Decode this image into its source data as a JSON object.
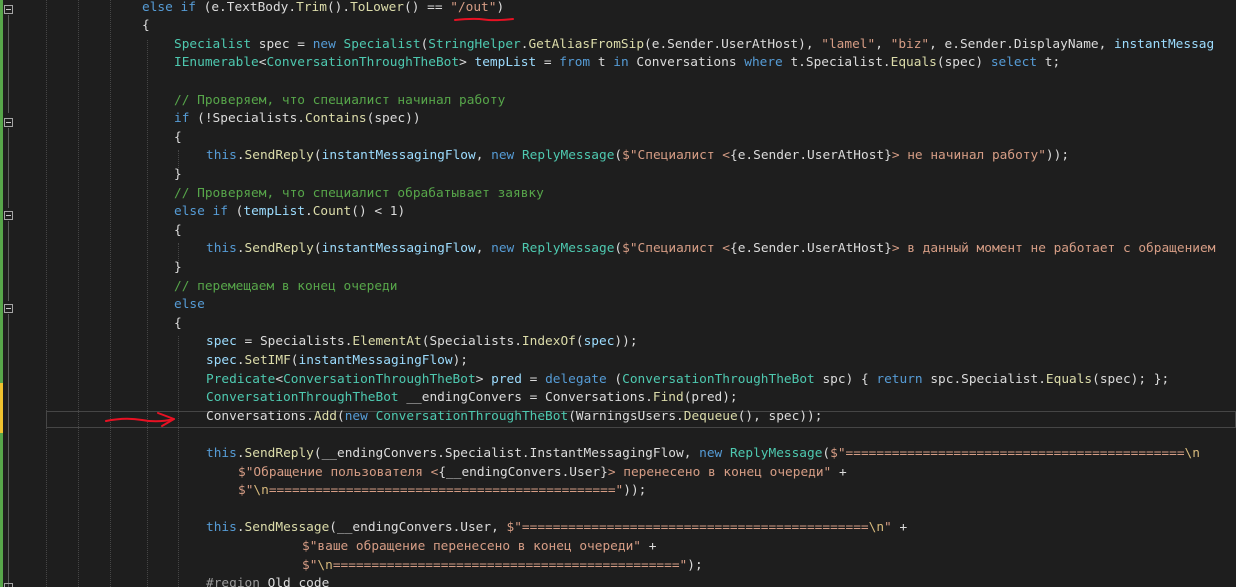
{
  "editor": {
    "lines": [
      [
        {
          "t": "else if",
          "c": "kw"
        },
        {
          "t": " (e.TextBody.",
          "c": "tx"
        },
        {
          "t": "Trim",
          "c": "me"
        },
        {
          "t": "().",
          "c": "tx"
        },
        {
          "t": "ToLower",
          "c": "me"
        },
        {
          "t": "() == ",
          "c": "tx"
        },
        {
          "t": "\"/out\"",
          "c": "st"
        },
        {
          "t": ")",
          "c": "tx"
        }
      ],
      [
        {
          "t": "{",
          "c": "tx"
        }
      ],
      [
        {
          "t": "Specialist",
          "c": "ty"
        },
        {
          "t": " spec = ",
          "c": "tx"
        },
        {
          "t": "new",
          "c": "kw"
        },
        {
          "t": " ",
          "c": "tx"
        },
        {
          "t": "Specialist",
          "c": "ty"
        },
        {
          "t": "(",
          "c": "tx"
        },
        {
          "t": "StringHelper",
          "c": "ty"
        },
        {
          "t": ".",
          "c": "tx"
        },
        {
          "t": "GetAliasFromSip",
          "c": "me"
        },
        {
          "t": "(e.Sender.UserAtHost), ",
          "c": "tx"
        },
        {
          "t": "\"lamel\"",
          "c": "st"
        },
        {
          "t": ", ",
          "c": "tx"
        },
        {
          "t": "\"biz\"",
          "c": "st"
        },
        {
          "t": ", e.Sender.DisplayName, ",
          "c": "tx"
        },
        {
          "t": "instantMessag",
          "c": "pa"
        }
      ],
      [
        {
          "t": "IEnumerable",
          "c": "ty"
        },
        {
          "t": "<",
          "c": "tx"
        },
        {
          "t": "ConversationThroughTheBot",
          "c": "ty"
        },
        {
          "t": "> ",
          "c": "tx"
        },
        {
          "t": "tempList",
          "c": "pa"
        },
        {
          "t": " = ",
          "c": "tx"
        },
        {
          "t": "from",
          "c": "kw"
        },
        {
          "t": " t ",
          "c": "tx"
        },
        {
          "t": "in",
          "c": "kw"
        },
        {
          "t": " Conversations ",
          "c": "tx"
        },
        {
          "t": "where",
          "c": "kw"
        },
        {
          "t": " t.Specialist.",
          "c": "tx"
        },
        {
          "t": "Equals",
          "c": "me"
        },
        {
          "t": "(spec) ",
          "c": "tx"
        },
        {
          "t": "select",
          "c": "kw"
        },
        {
          "t": " t;",
          "c": "tx"
        }
      ],
      [],
      [
        {
          "t": "// Проверяем, что специалист начинал работу",
          "c": "cm"
        }
      ],
      [
        {
          "t": "if",
          "c": "kw"
        },
        {
          "t": " (!Specialists.",
          "c": "tx"
        },
        {
          "t": "Contains",
          "c": "me"
        },
        {
          "t": "(spec))",
          "c": "tx"
        }
      ],
      [
        {
          "t": "{",
          "c": "tx"
        }
      ],
      [
        {
          "t": "this",
          "c": "kw"
        },
        {
          "t": ".",
          "c": "tx"
        },
        {
          "t": "SendReply",
          "c": "me"
        },
        {
          "t": "(",
          "c": "tx"
        },
        {
          "t": "instantMessagingFlow",
          "c": "pa"
        },
        {
          "t": ", ",
          "c": "tx"
        },
        {
          "t": "new",
          "c": "kw"
        },
        {
          "t": " ",
          "c": "tx"
        },
        {
          "t": "ReplyMessage",
          "c": "ty"
        },
        {
          "t": "(",
          "c": "tx"
        },
        {
          "t": "$\"Специалист <",
          "c": "st"
        },
        {
          "t": "{e.Sender.UserAtHost}",
          "c": "tx"
        },
        {
          "t": "> не начинал работу\"",
          "c": "st"
        },
        {
          "t": "));",
          "c": "tx"
        }
      ],
      [
        {
          "t": "}",
          "c": "tx"
        }
      ],
      [
        {
          "t": "// Проверяем, что специалист обрабатывает заявку",
          "c": "cm"
        }
      ],
      [
        {
          "t": "else if",
          "c": "kw"
        },
        {
          "t": " (",
          "c": "tx"
        },
        {
          "t": "tempList",
          "c": "pa"
        },
        {
          "t": ".",
          "c": "tx"
        },
        {
          "t": "Count",
          "c": "me"
        },
        {
          "t": "() < 1)",
          "c": "tx"
        }
      ],
      [
        {
          "t": "{",
          "c": "tx"
        }
      ],
      [
        {
          "t": "this",
          "c": "kw"
        },
        {
          "t": ".",
          "c": "tx"
        },
        {
          "t": "SendReply",
          "c": "me"
        },
        {
          "t": "(",
          "c": "tx"
        },
        {
          "t": "instantMessagingFlow",
          "c": "pa"
        },
        {
          "t": ", ",
          "c": "tx"
        },
        {
          "t": "new",
          "c": "kw"
        },
        {
          "t": " ",
          "c": "tx"
        },
        {
          "t": "ReplyMessage",
          "c": "ty"
        },
        {
          "t": "(",
          "c": "tx"
        },
        {
          "t": "$\"Специалист <",
          "c": "st"
        },
        {
          "t": "{e.Sender.UserAtHost}",
          "c": "tx"
        },
        {
          "t": "> в данный момент не работает с обращением",
          "c": "st"
        }
      ],
      [
        {
          "t": "}",
          "c": "tx"
        }
      ],
      [
        {
          "t": "// перемещаем в конец очереди",
          "c": "cm"
        }
      ],
      [
        {
          "t": "else",
          "c": "kw"
        }
      ],
      [
        {
          "t": "{",
          "c": "tx"
        }
      ],
      [
        {
          "t": "spec",
          "c": "pa"
        },
        {
          "t": " = Specialists.",
          "c": "tx"
        },
        {
          "t": "ElementAt",
          "c": "me"
        },
        {
          "t": "(Specialists.",
          "c": "tx"
        },
        {
          "t": "IndexOf",
          "c": "me"
        },
        {
          "t": "(",
          "c": "tx"
        },
        {
          "t": "spec",
          "c": "pa"
        },
        {
          "t": "));",
          "c": "tx"
        }
      ],
      [
        {
          "t": "spec",
          "c": "pa"
        },
        {
          "t": ".",
          "c": "tx"
        },
        {
          "t": "SetIMF",
          "c": "me"
        },
        {
          "t": "(",
          "c": "tx"
        },
        {
          "t": "instantMessagingFlow",
          "c": "pa"
        },
        {
          "t": ");",
          "c": "tx"
        }
      ],
      [
        {
          "t": "Predicate",
          "c": "ty"
        },
        {
          "t": "<",
          "c": "tx"
        },
        {
          "t": "ConversationThroughTheBot",
          "c": "ty"
        },
        {
          "t": "> ",
          "c": "tx"
        },
        {
          "t": "pred",
          "c": "pa"
        },
        {
          "t": " = ",
          "c": "tx"
        },
        {
          "t": "delegate",
          "c": "kw"
        },
        {
          "t": " (",
          "c": "tx"
        },
        {
          "t": "ConversationThroughTheBot",
          "c": "ty"
        },
        {
          "t": " spc) { ",
          "c": "tx"
        },
        {
          "t": "return",
          "c": "kw"
        },
        {
          "t": " spc.Specialist.",
          "c": "tx"
        },
        {
          "t": "Equals",
          "c": "me"
        },
        {
          "t": "(spec); };",
          "c": "tx"
        }
      ],
      [
        {
          "t": "ConversationThroughTheBot",
          "c": "ty"
        },
        {
          "t": " __endingConvers = Conversations.",
          "c": "tx"
        },
        {
          "t": "Find",
          "c": "me"
        },
        {
          "t": "(pred);",
          "c": "tx"
        }
      ],
      [
        {
          "t": "Conversations.",
          "c": "tx"
        },
        {
          "t": "Add",
          "c": "me"
        },
        {
          "t": "(",
          "c": "tx"
        },
        {
          "t": "new",
          "c": "kw"
        },
        {
          "t": " ",
          "c": "tx"
        },
        {
          "t": "ConversationThroughTheBot",
          "c": "ty"
        },
        {
          "t": "(WarningsUsers.",
          "c": "tx"
        },
        {
          "t": "Dequeue",
          "c": "me"
        },
        {
          "t": "(), spec));",
          "c": "tx"
        }
      ],
      [],
      [
        {
          "t": "this",
          "c": "kw"
        },
        {
          "t": ".",
          "c": "tx"
        },
        {
          "t": "SendReply",
          "c": "me"
        },
        {
          "t": "(__endingConvers.Specialist.InstantMessagingFlow, ",
          "c": "tx"
        },
        {
          "t": "new",
          "c": "kw"
        },
        {
          "t": " ",
          "c": "tx"
        },
        {
          "t": "ReplyMessage",
          "c": "ty"
        },
        {
          "t": "(",
          "c": "tx"
        },
        {
          "t": "$\"============================================",
          "c": "st"
        },
        {
          "t": "\\n",
          "c": "ke"
        }
      ],
      [
        {
          "t": "$\"Обращение пользователя <",
          "c": "st"
        },
        {
          "t": "{__endingConvers.User}",
          "c": "tx"
        },
        {
          "t": "> перенесено в конец очереди\"",
          "c": "st"
        },
        {
          "t": " +",
          "c": "tx"
        }
      ],
      [
        {
          "t": "$\"",
          "c": "st"
        },
        {
          "t": "\\n",
          "c": "ke"
        },
        {
          "t": "=============================================\"",
          "c": "st"
        },
        {
          "t": "));",
          "c": "tx"
        }
      ],
      [],
      [
        {
          "t": "this",
          "c": "kw"
        },
        {
          "t": ".",
          "c": "tx"
        },
        {
          "t": "SendMessage",
          "c": "me"
        },
        {
          "t": "(__endingConvers.User, ",
          "c": "tx"
        },
        {
          "t": "$\"=============================================",
          "c": "st"
        },
        {
          "t": "\\n",
          "c": "ke"
        },
        {
          "t": "\"",
          "c": "st"
        },
        {
          "t": " +",
          "c": "tx"
        }
      ],
      [
        {
          "t": "$\"ваше обращение перенесено в конец очереди\"",
          "c": "st"
        },
        {
          "t": " +",
          "c": "tx"
        }
      ],
      [
        {
          "t": "$\"",
          "c": "st"
        },
        {
          "t": "\\n",
          "c": "ke"
        },
        {
          "t": "=============================================\"",
          "c": "st"
        },
        {
          "t": ");",
          "c": "tx"
        }
      ],
      [
        {
          "t": "#region",
          "c": "pp"
        },
        {
          "t": " Old code",
          "c": "tx"
        }
      ]
    ]
  },
  "colors": {
    "background": "#1e1e1e",
    "keyword": "#569cd6",
    "type": "#4ec9b0",
    "string": "#d69d85",
    "comment": "#57a64a",
    "method": "#dcdcaa",
    "local": "#9cdcfe",
    "annotation": "#e81123"
  }
}
